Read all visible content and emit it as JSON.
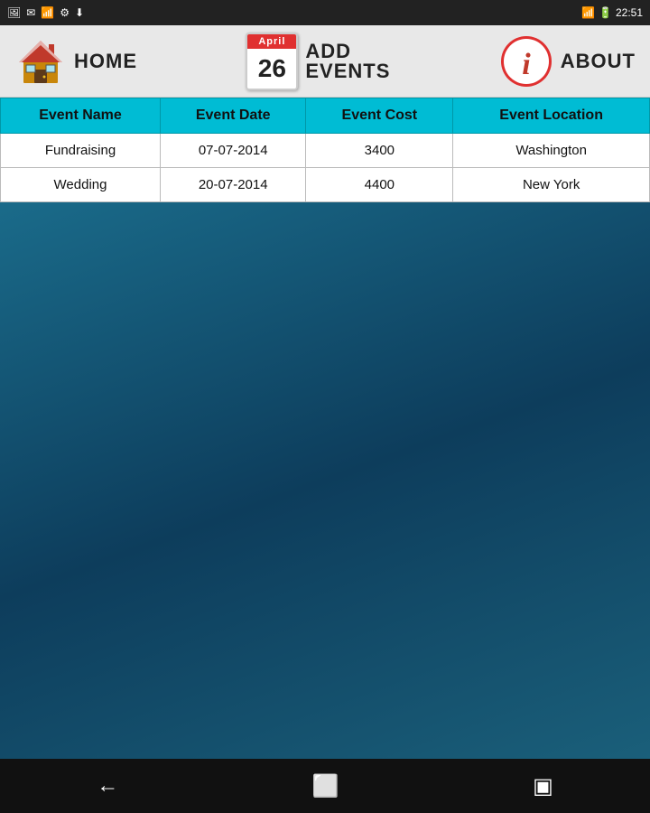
{
  "statusBar": {
    "time": "22:51",
    "icons": [
      "picture",
      "mail",
      "wifi",
      "usb",
      "download"
    ]
  },
  "nav": {
    "homeLabel": "HOME",
    "calendarMonth": "April",
    "calendarDay": "26",
    "addEventsLine1": "ADD",
    "addEventsLine2": "EVENTS",
    "aboutLabel": "ABOUT"
  },
  "table": {
    "columns": [
      "Event Name",
      "Event Date",
      "Event Cost",
      "Event Location"
    ],
    "rows": [
      [
        "Fundraising",
        "07-07-2014",
        "3400",
        "Washington"
      ],
      [
        "Wedding",
        "20-07-2014",
        "4400",
        "New York"
      ]
    ]
  },
  "bottomNav": {
    "back": "←",
    "home": "⬜",
    "recent": "▣"
  }
}
